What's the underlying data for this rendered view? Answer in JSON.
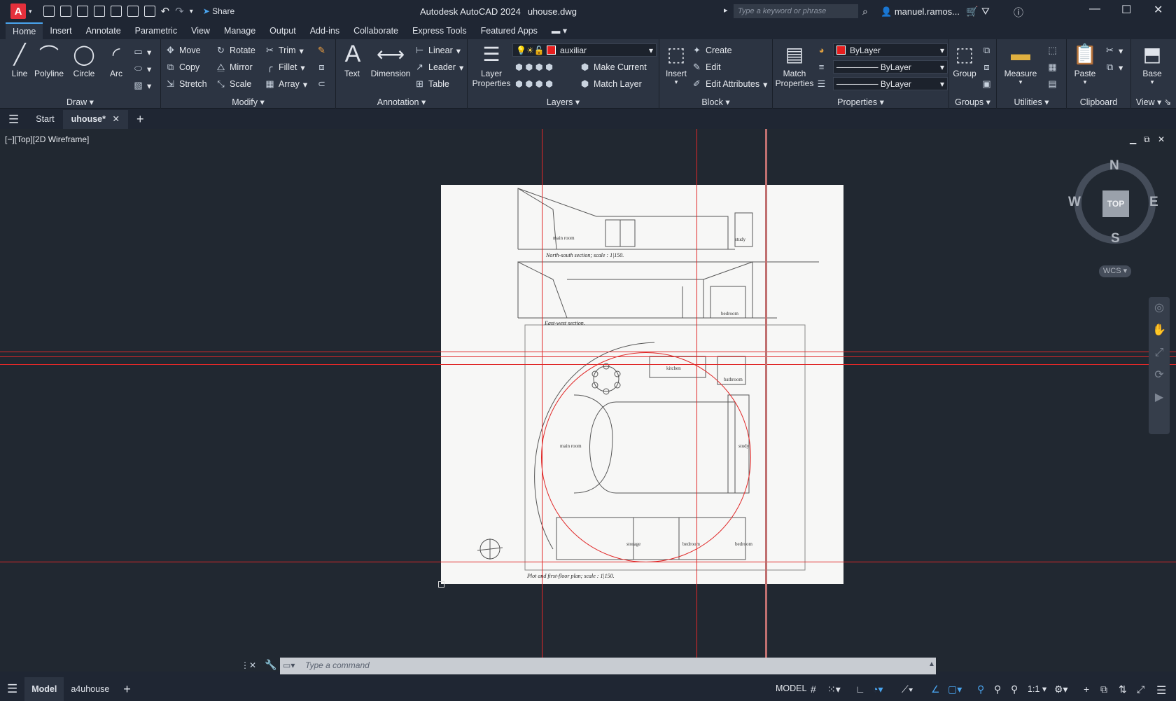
{
  "app": {
    "title": "Autodesk AutoCAD 2024",
    "file": "uhouse.dwg",
    "logo": "A",
    "share": "Share",
    "search_placeholder": "Type a keyword or phrase",
    "user": "manuel.ramos..."
  },
  "ribbon_tabs": [
    "Home",
    "Insert",
    "Annotate",
    "Parametric",
    "View",
    "Manage",
    "Output",
    "Add-ins",
    "Collaborate",
    "Express Tools",
    "Featured Apps"
  ],
  "ribbon": {
    "draw": {
      "title": "Draw",
      "line": "Line",
      "polyline": "Polyline",
      "circle": "Circle",
      "arc": "Arc"
    },
    "modify": {
      "title": "Modify",
      "move": "Move",
      "rotate": "Rotate",
      "trim": "Trim",
      "copy": "Copy",
      "mirror": "Mirror",
      "fillet": "Fillet",
      "stretch": "Stretch",
      "scale": "Scale",
      "array": "Array"
    },
    "annotation": {
      "title": "Annotation",
      "text": "Text",
      "dimension": "Dimension",
      "linear": "Linear",
      "leader": "Leader",
      "table": "Table"
    },
    "layers": {
      "title": "Layers",
      "layer_properties_1": "Layer",
      "layer_properties_2": "Properties",
      "current_layer": "auxiliar",
      "make_current": "Make Current",
      "match_layer": "Match Layer"
    },
    "block": {
      "title": "Block",
      "insert": "Insert",
      "create": "Create",
      "edit": "Edit",
      "edit_attributes": "Edit Attributes"
    },
    "properties": {
      "title": "Properties",
      "match_1": "Match",
      "match_2": "Properties",
      "color": "ByLayer",
      "linetype": "ByLayer",
      "lineweight": "ByLayer"
    },
    "groups": {
      "title": "Groups",
      "group": "Group"
    },
    "utilities": {
      "title": "Utilities",
      "measure": "Measure"
    },
    "clipboard": {
      "title": "Clipboard",
      "paste": "Paste"
    },
    "view": {
      "title": "View",
      "base": "Base"
    }
  },
  "file_tabs": {
    "start": "Start",
    "current": "uhouse*"
  },
  "viewport": {
    "label": "[−][Top][2D Wireframe]",
    "viewcube": {
      "top": "TOP",
      "n": "N",
      "s": "S",
      "e": "E",
      "w": "W",
      "wcs": "WCS"
    }
  },
  "drawing": {
    "ns_caption": "North-south section; scale : 1|150.",
    "ew_caption": "East-west section.",
    "plan_caption": "Plot and first-floor plan; scale : 1|150.",
    "labels": [
      "main room",
      "study",
      "bedroom",
      "kitchen",
      "bathroom",
      "main room",
      "study",
      "storage",
      "bedroom",
      "bedroom"
    ]
  },
  "command": {
    "placeholder": "Type a command"
  },
  "status": {
    "model_tab": "Model",
    "layout_tab": "a4uhouse",
    "mode": "MODEL",
    "scale": "1:1"
  },
  "colors": {
    "accent": "#4aa5f0",
    "construction_line": "#e02828",
    "brand": "#e5303c"
  }
}
